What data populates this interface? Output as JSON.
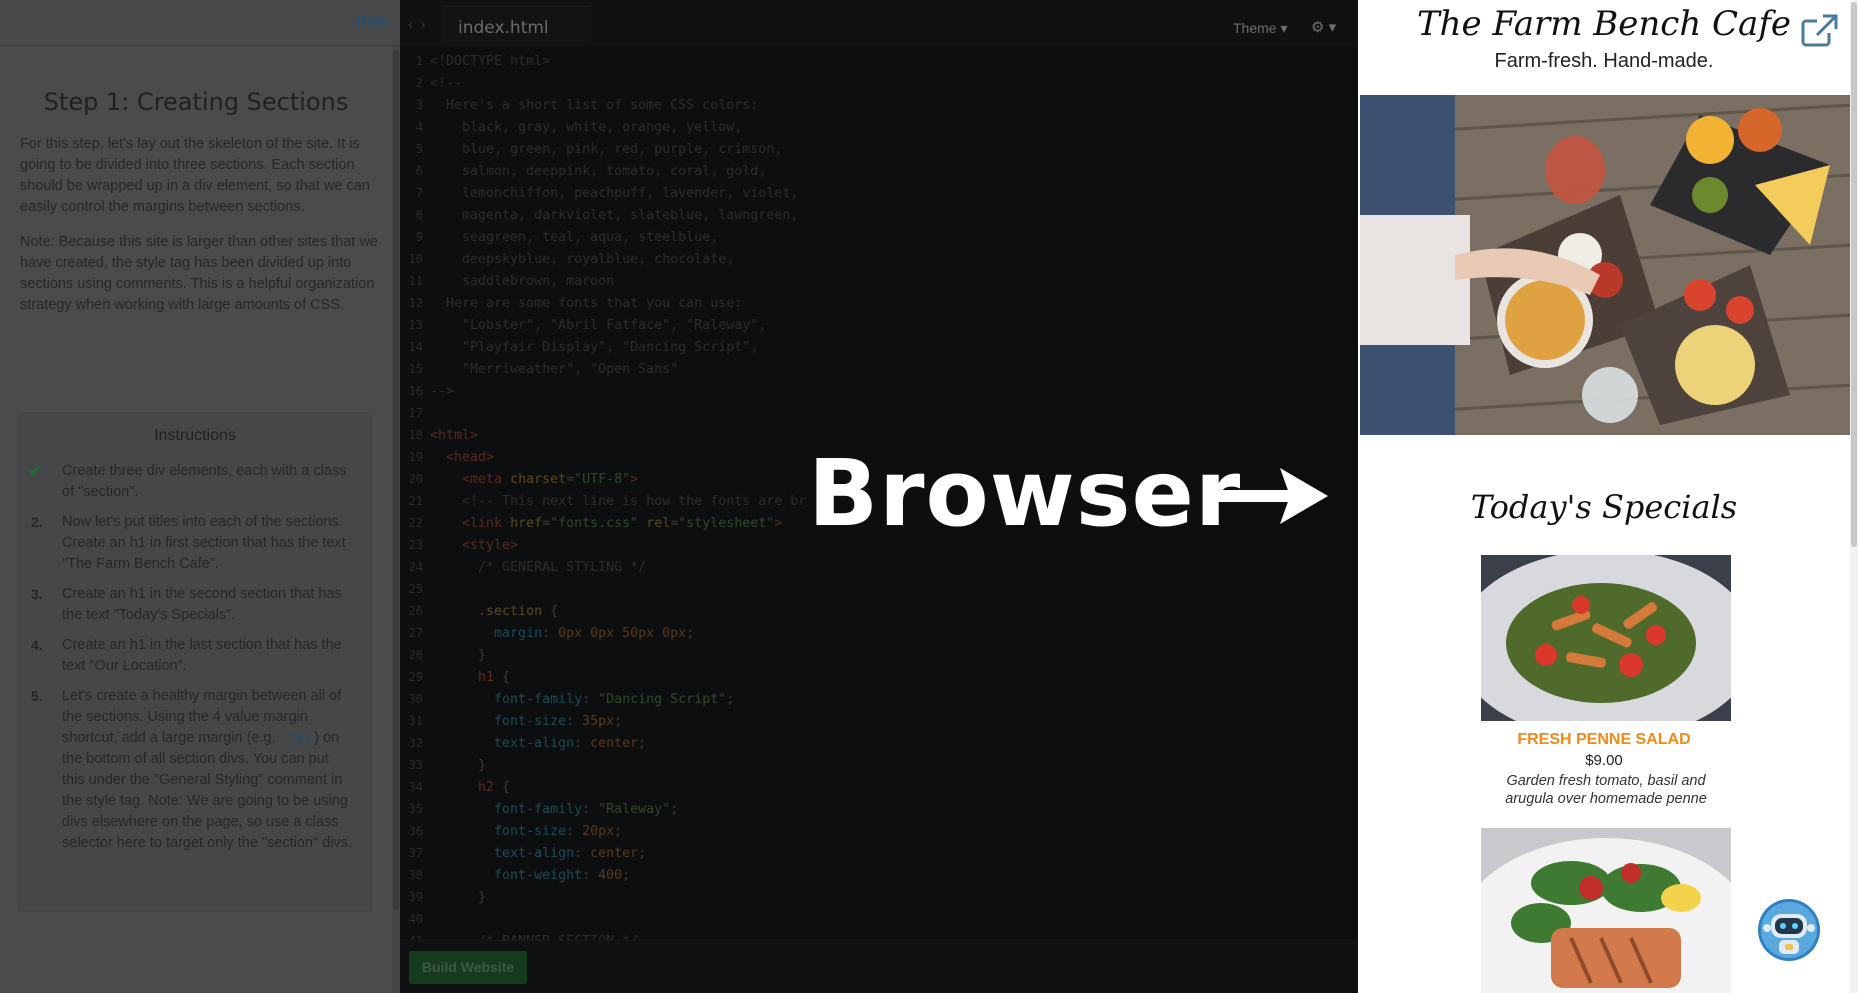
{
  "left_panel": {
    "hide_label": "Hide",
    "title": "Step 1: Creating Sections",
    "paragraphs": [
      "For this step, let's lay out the skeleton of the site. It is going to be divided into three sections. Each section should be wrapped up in a div element, so that we can easily control the margins between sections.",
      "Note: Because this site is larger than other sites that we have created, the style tag has been divided up into sections using comments. This is a helpful organization strategy when working with large amounts of CSS."
    ],
    "instructions_title": "Instructions",
    "steps": [
      {
        "marker": "✔",
        "text": "Create three div elements, each with a class of \"section\"."
      },
      {
        "marker": "2.",
        "text": "Now let's put titles into each of the sections. Create an h1 in first section that has the text \"The Farm Bench Cafe\"."
      },
      {
        "marker": "3.",
        "text": "Create an h1 in the second section that has the text \"Today's Specials\"."
      },
      {
        "marker": "4.",
        "text": "Create an h1 in the last section that has the text \"Our Location\"."
      },
      {
        "marker": "5.",
        "text_before": "Let's create a healthy margin between all of the sections. Using the 4 value margin shortcut, add a large margin (e.g.",
        "inline_code": "50px",
        "text_after": ") on the bottom of all section divs. You can put this under the \"General Styling\" comment in the style tag. Note: We are going to be using divs elsewhere on the page, so use a class selector here to target only the \"section\" divs."
      }
    ]
  },
  "editor": {
    "tab_label": "index.html",
    "theme_label": "Theme ▾",
    "settings_label": "⚙ ▾",
    "build_button": "Build Website",
    "lines": [
      {
        "n": "1",
        "segs": [
          [
            "c-com",
            "<!DOCTYPE html>"
          ]
        ]
      },
      {
        "n": "2",
        "segs": [
          [
            "c-com",
            "<!--"
          ]
        ]
      },
      {
        "n": "3",
        "segs": [
          [
            "c-com",
            "  Here's a short list of some CSS colors:"
          ]
        ]
      },
      {
        "n": "4",
        "segs": [
          [
            "c-com",
            "    black, gray, white, orange, yellow,"
          ]
        ]
      },
      {
        "n": "5",
        "segs": [
          [
            "c-com",
            "    blue, green, pink, red, purple, crimson,"
          ]
        ]
      },
      {
        "n": "6",
        "segs": [
          [
            "c-com",
            "    salmon, deeppink, tomato, coral, gold,"
          ]
        ]
      },
      {
        "n": "7",
        "segs": [
          [
            "c-com",
            "    lemonchiffon, peachpuff, lavender, violet,"
          ]
        ]
      },
      {
        "n": "8",
        "segs": [
          [
            "c-com",
            "    magenta, darkviolet, slateblue, lawngreen,"
          ]
        ]
      },
      {
        "n": "9",
        "segs": [
          [
            "c-com",
            "    seagreen, teal, aqua, steelblue,"
          ]
        ]
      },
      {
        "n": "10",
        "segs": [
          [
            "c-com",
            "    deepskyblue, royalblue, chocolate,"
          ]
        ]
      },
      {
        "n": "11",
        "segs": [
          [
            "c-com",
            "    saddlebrown, maroon"
          ]
        ]
      },
      {
        "n": "12",
        "segs": [
          [
            "c-com",
            "  Here are some fonts that you can use:"
          ]
        ]
      },
      {
        "n": "13",
        "segs": [
          [
            "c-com",
            "    \"Lobster\", \"Abril Fatface\", \"Raleway\","
          ]
        ]
      },
      {
        "n": "14",
        "segs": [
          [
            "c-com",
            "    \"Playfair Display\", \"Dancing Script\","
          ]
        ]
      },
      {
        "n": "15",
        "segs": [
          [
            "c-com",
            "    \"Merriweather\", \"Open Sans\""
          ]
        ]
      },
      {
        "n": "16",
        "segs": [
          [
            "c-com",
            "-->"
          ]
        ]
      },
      {
        "n": "17",
        "segs": [
          [
            "c-txt",
            ""
          ]
        ]
      },
      {
        "n": "18",
        "segs": [
          [
            "c-tag",
            "<html>"
          ]
        ]
      },
      {
        "n": "19",
        "segs": [
          [
            "c-tag",
            "  <head>"
          ]
        ]
      },
      {
        "n": "20",
        "segs": [
          [
            "c-tag",
            "    <meta "
          ],
          [
            "c-attr",
            "charset"
          ],
          [
            "c-txt",
            "="
          ],
          [
            "c-str",
            "\"UTF-8\""
          ],
          [
            "c-tag",
            ">"
          ]
        ]
      },
      {
        "n": "21",
        "segs": [
          [
            "c-com",
            "    <!-- This next line is how the fonts are br"
          ]
        ]
      },
      {
        "n": "22",
        "segs": [
          [
            "c-tag",
            "    <link "
          ],
          [
            "c-attr",
            "href"
          ],
          [
            "c-txt",
            "="
          ],
          [
            "c-str",
            "\"fonts.css\""
          ],
          [
            "c-txt",
            " "
          ],
          [
            "c-attr",
            "rel"
          ],
          [
            "c-txt",
            "="
          ],
          [
            "c-str",
            "\"stylesheet\""
          ],
          [
            "c-tag",
            ">"
          ]
        ]
      },
      {
        "n": "23",
        "segs": [
          [
            "c-tag",
            "    <style>"
          ]
        ]
      },
      {
        "n": "24",
        "segs": [
          [
            "c-com",
            "      /* GENERAL STYLING */"
          ]
        ]
      },
      {
        "n": "25",
        "segs": [
          [
            "c-txt",
            ""
          ]
        ]
      },
      {
        "n": "26",
        "segs": [
          [
            "c-sel",
            "      .section"
          ],
          [
            "c-txt",
            " {"
          ]
        ]
      },
      {
        "n": "27",
        "segs": [
          [
            "c-prop",
            "        margin"
          ],
          [
            "c-txt",
            ": "
          ],
          [
            "c-num",
            "0px 0px 50px 0px"
          ],
          [
            "c-txt",
            ";"
          ]
        ]
      },
      {
        "n": "28",
        "segs": [
          [
            "c-txt",
            "      }"
          ]
        ]
      },
      {
        "n": "29",
        "segs": [
          [
            "c-tag",
            "      h1"
          ],
          [
            "c-txt",
            " {"
          ]
        ]
      },
      {
        "n": "30",
        "segs": [
          [
            "c-prop",
            "        font-family"
          ],
          [
            "c-txt",
            ": "
          ],
          [
            "c-str",
            "\"Dancing Script\""
          ],
          [
            "c-txt",
            ";"
          ]
        ]
      },
      {
        "n": "31",
        "segs": [
          [
            "c-prop",
            "        font-size"
          ],
          [
            "c-txt",
            ": "
          ],
          [
            "c-num",
            "35px"
          ],
          [
            "c-txt",
            ";"
          ]
        ]
      },
      {
        "n": "32",
        "segs": [
          [
            "c-prop",
            "        text-align"
          ],
          [
            "c-txt",
            ": "
          ],
          [
            "c-num",
            "center"
          ],
          [
            "c-txt",
            ";"
          ]
        ]
      },
      {
        "n": "33",
        "segs": [
          [
            "c-txt",
            "      }"
          ]
        ]
      },
      {
        "n": "34",
        "segs": [
          [
            "c-tag",
            "      h2"
          ],
          [
            "c-txt",
            " {"
          ]
        ]
      },
      {
        "n": "35",
        "segs": [
          [
            "c-prop",
            "        font-family"
          ],
          [
            "c-txt",
            ": "
          ],
          [
            "c-str",
            "\"Raleway\""
          ],
          [
            "c-txt",
            ";"
          ]
        ]
      },
      {
        "n": "36",
        "segs": [
          [
            "c-prop",
            "        font-size"
          ],
          [
            "c-txt",
            ": "
          ],
          [
            "c-num",
            "20px"
          ],
          [
            "c-txt",
            ";"
          ]
        ]
      },
      {
        "n": "37",
        "segs": [
          [
            "c-prop",
            "        text-align"
          ],
          [
            "c-txt",
            ": "
          ],
          [
            "c-num",
            "center"
          ],
          [
            "c-txt",
            ";"
          ]
        ]
      },
      {
        "n": "38",
        "segs": [
          [
            "c-prop",
            "        font-weight"
          ],
          [
            "c-txt",
            ": "
          ],
          [
            "c-num",
            "400"
          ],
          [
            "c-txt",
            ";"
          ]
        ]
      },
      {
        "n": "39",
        "segs": [
          [
            "c-txt",
            "      }"
          ]
        ]
      },
      {
        "n": "40",
        "segs": [
          [
            "c-txt",
            ""
          ]
        ]
      },
      {
        "n": "41",
        "segs": [
          [
            "c-com",
            "      /* BANNER SECTION */"
          ]
        ]
      }
    ]
  },
  "overlay": {
    "word": "Browser"
  },
  "preview": {
    "site_title": "The Farm Bench Cafe",
    "tagline": "Farm-fresh. Hand-made.",
    "specials_title": "Today's Specials",
    "dish_name": "FRESH PENNE SALAD",
    "dish_price": "$9.00",
    "dish_description": "Garden fresh tomato, basil and arugula over homemade penne"
  },
  "colors": {
    "accent_orange": "#f08a1b",
    "build_green": "#163a1e",
    "check_green": "#1f6b37"
  }
}
